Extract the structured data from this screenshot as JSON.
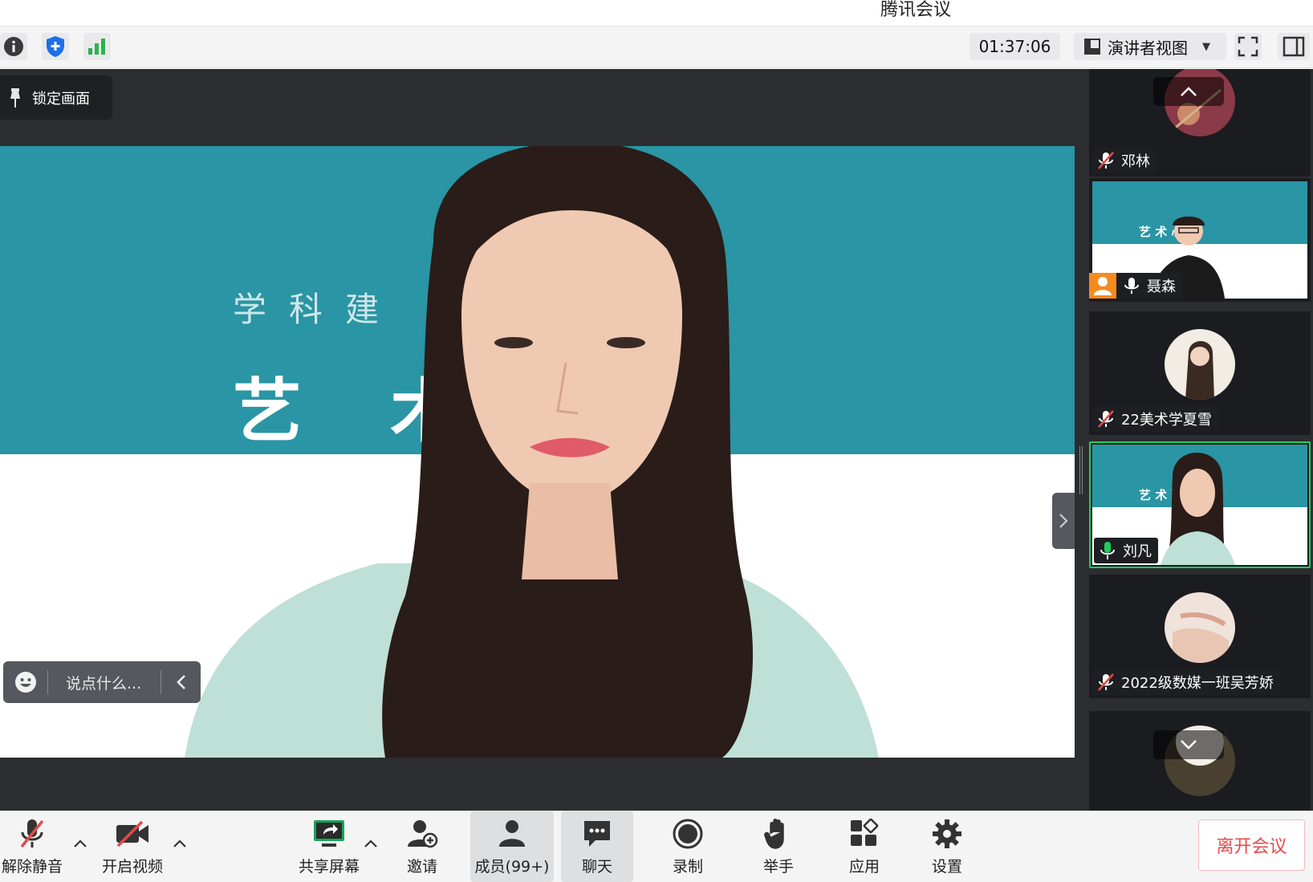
{
  "app": {
    "title": "腾讯会议"
  },
  "toolbar": {
    "timer": "01:37:06",
    "view_mode": "演讲者视图"
  },
  "stage": {
    "lock_label": "锁定画面",
    "slide_subtitle": "学科建                  流讲座",
    "slide_title": "艺术   理",
    "chat_placeholder": "说点什么..."
  },
  "participants": [
    {
      "name": "邓林",
      "muted": true,
      "kind": "avatar"
    },
    {
      "name": "聂森",
      "muted": false,
      "kind": "video"
    },
    {
      "name": "22美术学夏雪",
      "muted": true,
      "kind": "avatar"
    },
    {
      "name": "刘凡",
      "muted": false,
      "kind": "video",
      "speaking": true
    },
    {
      "name": "2022级数媒一班吴芳娇",
      "muted": true,
      "kind": "avatar"
    }
  ],
  "bottombar": {
    "unmute": "解除静音",
    "start_video": "开启视频",
    "share_screen": "共享屏幕",
    "invite": "邀请",
    "members": "成员(99+)",
    "chat": "聊天",
    "record": "录制",
    "raise_hand": "举手",
    "apps": "应用",
    "settings": "设置",
    "leave": "离开会议"
  },
  "colors": {
    "accent_green": "#1ecf5e",
    "danger": "#e24b4b",
    "slide_teal": "#2a95a4",
    "stage_bg": "#2b2d31"
  }
}
